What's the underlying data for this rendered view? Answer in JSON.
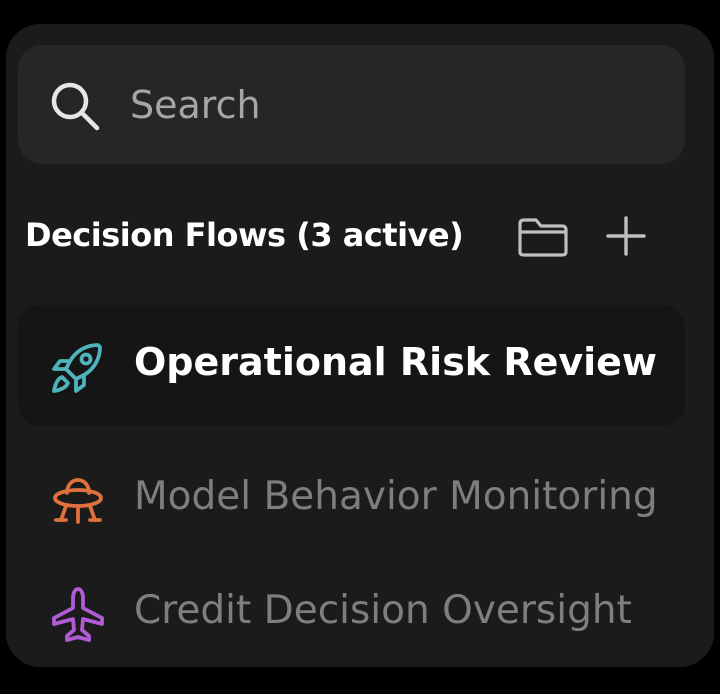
{
  "search": {
    "placeholder": "Search",
    "value": ""
  },
  "section": {
    "title": "Decision Flows (3 active)",
    "actions": [
      "folder-icon",
      "plus-icon"
    ]
  },
  "flows": [
    {
      "label": "Operational Risk Review",
      "icon": "rocket-icon",
      "color": "#4fb3bd",
      "selected": true
    },
    {
      "label": "Model Behavior Monitoring",
      "icon": "ufo-icon",
      "color": "#e0703d",
      "selected": false
    },
    {
      "label": "Credit Decision Oversight",
      "icon": "airplane-icon",
      "color": "#b25bd6",
      "selected": false
    }
  ],
  "colors": {
    "background": "#000000",
    "panel": "#1b1b1b",
    "search_bg": "#262626",
    "active_item_bg": "#151515",
    "text_primary": "#ffffff",
    "text_muted": "#7e7e7e"
  }
}
